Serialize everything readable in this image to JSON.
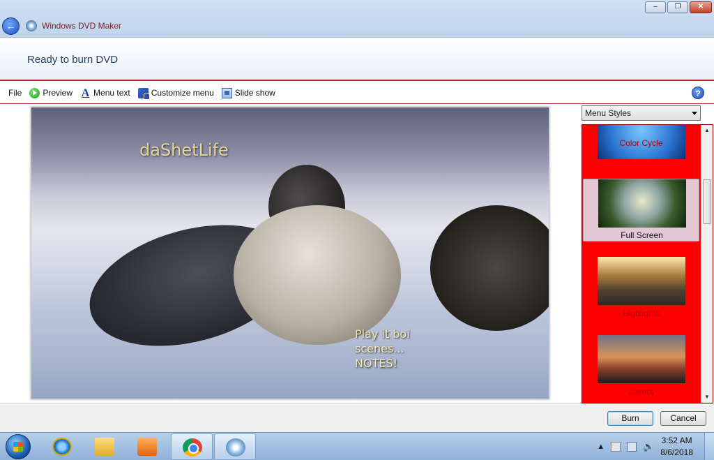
{
  "window": {
    "title": "Windows DVD Maker",
    "controls": {
      "minimize": "–",
      "restore": "❐",
      "close": "✕"
    }
  },
  "header": {
    "title": "Ready to burn DVD"
  },
  "toolbar": {
    "file": "File",
    "preview": "Preview",
    "menu_text": "Menu text",
    "customize_menu": "Customize menu",
    "slide_show": "Slide show",
    "help": "?"
  },
  "preview": {
    "title_text": "daShetLife",
    "menu_lines": [
      "Play it boi",
      "scenes...",
      "NOTES!"
    ]
  },
  "styles_panel": {
    "dropdown_value": "Menu Styles",
    "items": [
      {
        "label": "Color Cycle",
        "selected": false
      },
      {
        "label": "Full Screen",
        "selected": true
      },
      {
        "label": "Highlights",
        "selected": false
      },
      {
        "label": "Layers",
        "selected": false
      }
    ]
  },
  "buttons": {
    "burn": "Burn",
    "cancel": "Cancel"
  },
  "taskbar": {
    "apps": [
      "internet-explorer",
      "file-explorer",
      "media-player",
      "chrome",
      "dvd-maker"
    ],
    "time": "3:52 AM",
    "date": "8/6/2018"
  },
  "colors": {
    "accent_red": "#ff0000",
    "header_rule": "#b52d2d",
    "title_text": "#7a1d1d"
  }
}
